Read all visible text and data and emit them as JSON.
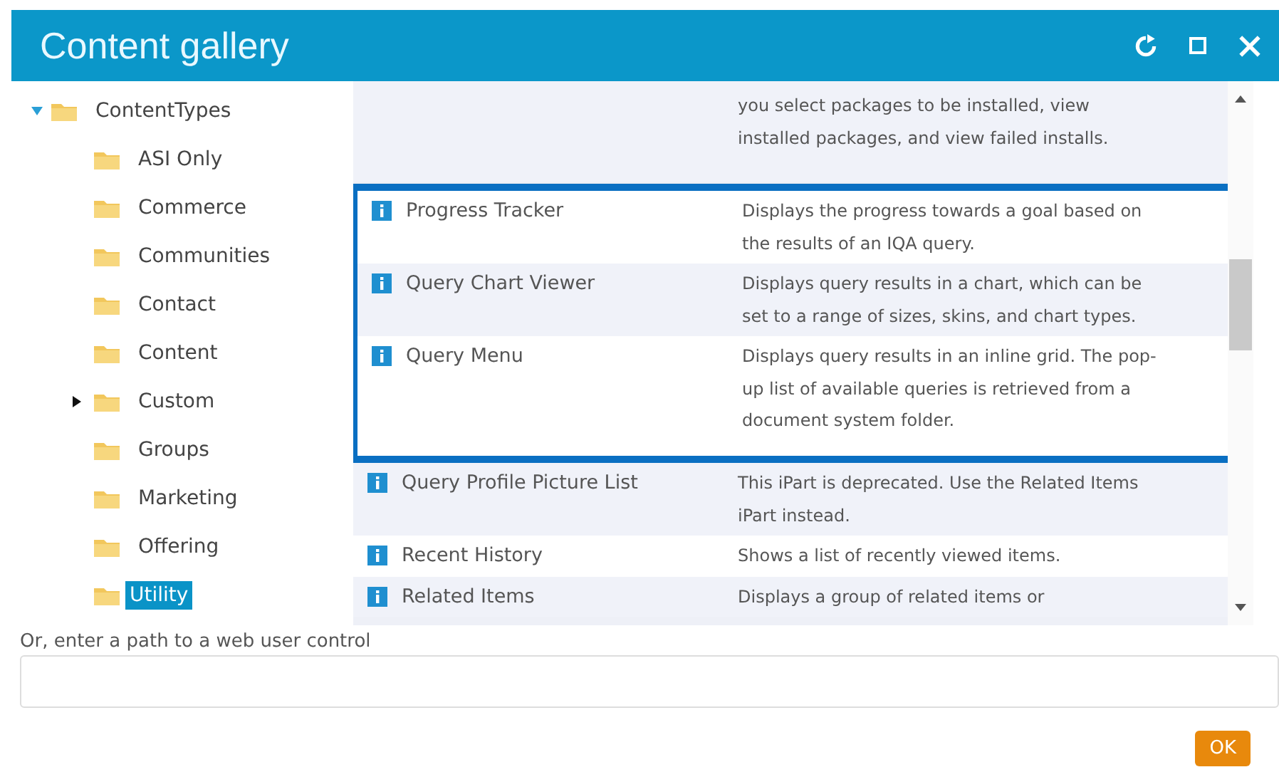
{
  "window": {
    "title": "Content gallery"
  },
  "tree": [
    {
      "label": "ContentTypes",
      "expanded": true,
      "selected": false,
      "children": [
        {
          "label": "ASI Only",
          "selected": false
        },
        {
          "label": "Commerce",
          "selected": false
        },
        {
          "label": "Communities",
          "selected": false
        },
        {
          "label": "Contact",
          "selected": false
        },
        {
          "label": "Content",
          "selected": false
        },
        {
          "label": "Custom",
          "selected": false,
          "expanded": false
        },
        {
          "label": "Groups",
          "selected": false
        },
        {
          "label": "Marketing",
          "selected": false
        },
        {
          "label": "Offering",
          "selected": false
        },
        {
          "label": "Utility",
          "selected": true
        }
      ]
    }
  ],
  "items": [
    {
      "description": "you select packages to be installed, view installed packages, and view failed installs.",
      "highlighted": false
    },
    {
      "name": "Progress Tracker",
      "description": "Displays the progress towards a goal based on the results of an IQA query.",
      "highlighted": true
    },
    {
      "name": "Query Chart Viewer",
      "description": "Displays query results in a chart, which can be set to a range of sizes, skins, and chart types.",
      "highlighted": true
    },
    {
      "name": "Query Menu",
      "description": "Displays query results in an inline grid. The pop-up list of available queries is retrieved from a document system folder.",
      "highlighted": true
    },
    {
      "name": "Query Profile Picture List",
      "description": "This iPart is deprecated. Use the Related Items iPart instead.",
      "highlighted": false
    },
    {
      "name": "Recent History",
      "description": "Shows a list of recently viewed items.",
      "highlighted": false
    },
    {
      "name": "Related Items",
      "description": "Displays a group of related items or",
      "highlighted": false
    }
  ],
  "path_field": {
    "label": "Or, enter a path to a web user control"
  },
  "ok_button": "OK"
}
